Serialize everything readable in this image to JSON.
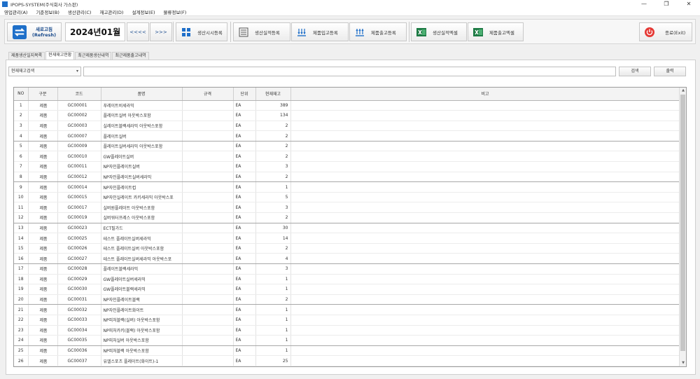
{
  "window": {
    "title": "IPOPS-SYSTEM(주식회사 가스판)",
    "controls": [
      "—",
      "❐",
      "✕"
    ]
  },
  "menu": [
    "영업관리(A)",
    "기준정보(B)",
    "생산관리(C)",
    "재고관리(D)",
    "설계정보(E)",
    "물류정보(F)"
  ],
  "toolbar": {
    "refresh": "새로고침\n(Refresh)",
    "period": "2024년01월",
    "prev": "<<<<",
    "next": ">>>",
    "buttons": [
      {
        "label": "생산시시등록",
        "icon": "grid-icon"
      },
      {
        "label": "생산실적등록",
        "icon": "list-icon"
      },
      {
        "label": "제품입고등록",
        "icon": "inbound-icon"
      },
      {
        "label": "제품출고등록",
        "icon": "outbound-icon"
      },
      {
        "label": "생산실적엑셀",
        "icon": "excel-icon"
      },
      {
        "label": "제품출고엑셀",
        "icon": "excel-icon"
      }
    ],
    "exit": "종료(Exit)"
  },
  "tabs": [
    "제품생산일지목록",
    "현재재고현황",
    "최근제품생산내역",
    "최근제품출고내역"
  ],
  "filter": {
    "select": "현재재고검색",
    "search": "검색",
    "print": "출력"
  },
  "columns": [
    "NO",
    "구분",
    "코드",
    "품명",
    "규격",
    "단위",
    "현재재고",
    "비고"
  ],
  "rows": [
    [
      "1",
      "제품",
      "GC00001",
      "푸레이트비세라믹",
      "",
      "EA",
      "389",
      ""
    ],
    [
      "2",
      "제품",
      "GC00002",
      "플레이트실버 아웃박스포함",
      "",
      "EA",
      "134",
      ""
    ],
    [
      "3",
      "제품",
      "GC00003",
      "실레이트블랙세라믹 아웃박스포함",
      "",
      "EA",
      "2",
      ""
    ],
    [
      "4",
      "제품",
      "GC00007",
      "플레이트실버",
      "",
      "EA",
      "2",
      ""
    ],
    [
      "5",
      "제품",
      "GC00009",
      "플레이트실버세라믹 아웃박스포함",
      "",
      "EA",
      "2",
      ""
    ],
    [
      "6",
      "제품",
      "GC00010",
      "GW플레이트실버",
      "",
      "EA",
      "2",
      ""
    ],
    [
      "7",
      "제품",
      "GC00011",
      "NP자인플레이트실버",
      "",
      "EA",
      "3",
      ""
    ],
    [
      "8",
      "제품",
      "GC00012",
      "NP자인플레이트실버세라믹",
      "",
      "EA",
      "2",
      ""
    ],
    [
      "9",
      "제품",
      "GC00014",
      "NP자인플레이트컵",
      "",
      "EA",
      "1",
      ""
    ],
    [
      "10",
      "제품",
      "GC00015",
      "NP자인실레이트 카키세라믹 아웃박스포",
      "",
      "EA",
      "5",
      ""
    ],
    [
      "11",
      "제품",
      "GC00017",
      "실버원플레이트 아웃박스포함",
      "",
      "EA",
      "3",
      ""
    ],
    [
      "12",
      "제품",
      "GC00019",
      "실버워터프레스 아웃박스포함",
      "",
      "EA",
      "2",
      ""
    ],
    [
      "13",
      "제품",
      "GC00023",
      "ECT필가드",
      "",
      "EA",
      "30",
      ""
    ],
    [
      "14",
      "제품",
      "GC00025",
      "테스트 플레이트실버세라믹",
      "",
      "EA",
      "14",
      ""
    ],
    [
      "15",
      "제품",
      "GC00026",
      "테스트 플레이트실버 아웃박스포함",
      "",
      "EA",
      "2",
      ""
    ],
    [
      "16",
      "제품",
      "GC00027",
      "테스트 플레이트실버세라믹 아웃박스포",
      "",
      "EA",
      "4",
      ""
    ],
    [
      "17",
      "제품",
      "GC00028",
      "플레이트블랙세라믹",
      "",
      "EA",
      "3",
      ""
    ],
    [
      "18",
      "제품",
      "GC00029",
      "GW플레이트실버세라믹",
      "",
      "EA",
      "1",
      ""
    ],
    [
      "19",
      "제품",
      "GC00030",
      "GW플레이트블랙세라믹",
      "",
      "EA",
      "1",
      ""
    ],
    [
      "20",
      "제품",
      "GC00031",
      "NP자인플레이트블랙",
      "",
      "EA",
      "2",
      ""
    ],
    [
      "21",
      "제품",
      "GC00032",
      "NP자인플레이트화이트",
      "",
      "EA",
      "1",
      ""
    ],
    [
      "22",
      "제품",
      "GC00033",
      "NP피처블랙(실버) 아웃박스포함",
      "",
      "EA",
      "1",
      ""
    ],
    [
      "23",
      "제품",
      "GC00034",
      "NP피처카키(블랙) 아웃박스포함",
      "",
      "EA",
      "1",
      ""
    ],
    [
      "24",
      "제품",
      "GC00035",
      "NP피처실버 아웃박스포함",
      "",
      "EA",
      "1",
      ""
    ],
    [
      "25",
      "제품",
      "GC00036",
      "NP피처블랙 아웃박스포함",
      "",
      "EA",
      "1",
      ""
    ],
    [
      "26",
      "제품",
      "GC00037",
      "유엘스포츠 플레이트(화이트)-1",
      "",
      "EA",
      "25",
      ""
    ]
  ],
  "colors": {
    "accent": "#1e6fc9",
    "exit": "#e53935",
    "excel": "#1e7b45"
  }
}
